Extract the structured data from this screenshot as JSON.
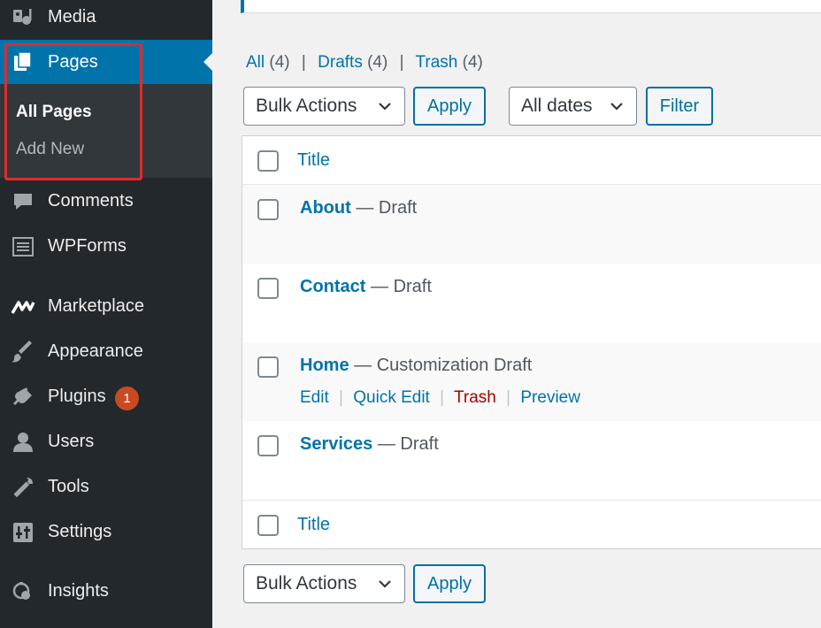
{
  "sidebar": {
    "menu": [
      {
        "label": "Media",
        "icon": "media-icon"
      },
      {
        "label": "Pages",
        "icon": "pages-icon",
        "active": true
      },
      {
        "label": "Comments",
        "icon": "comments-icon"
      },
      {
        "label": "WPForms",
        "icon": "wpforms-icon"
      },
      {
        "label": "Marketplace",
        "icon": "marketplace-icon"
      },
      {
        "label": "Appearance",
        "icon": "appearance-icon"
      },
      {
        "label": "Plugins",
        "icon": "plugins-icon",
        "badge": "1"
      },
      {
        "label": "Users",
        "icon": "users-icon"
      },
      {
        "label": "Tools",
        "icon": "tools-icon"
      },
      {
        "label": "Settings",
        "icon": "settings-icon"
      },
      {
        "label": "Insights",
        "icon": "insights-icon"
      }
    ],
    "submenu": [
      {
        "label": "All Pages",
        "current": true
      },
      {
        "label": "Add New"
      }
    ],
    "colors": {
      "background": "#23282d",
      "active": "#0073aa",
      "submenu": "#32373c",
      "highlight": "#e02b2b",
      "badge": "#ca4a1f"
    }
  },
  "views": {
    "all": {
      "label": "All",
      "count": "(4)"
    },
    "drafts": {
      "label": "Drafts",
      "count": "(4)"
    },
    "trash": {
      "label": "Trash",
      "count": "(4)"
    },
    "separator": "|"
  },
  "top_actions": {
    "bulk_select": "Bulk Actions",
    "apply": "Apply",
    "dates_select": "All dates",
    "filter": "Filter"
  },
  "table": {
    "header_title": "Title",
    "footer_title": "Title",
    "separator": "—",
    "rows": [
      {
        "title": "About",
        "state": "Draft"
      },
      {
        "title": "Contact",
        "state": "Draft"
      },
      {
        "title": "Home",
        "state": "Customization Draft",
        "actions": {
          "edit": "Edit",
          "quick_edit": "Quick Edit",
          "trash": "Trash",
          "preview": "Preview",
          "separator": "|"
        }
      },
      {
        "title": "Services",
        "state": "Draft"
      }
    ]
  },
  "bottom_actions": {
    "bulk_select": "Bulk Actions",
    "apply": "Apply"
  }
}
